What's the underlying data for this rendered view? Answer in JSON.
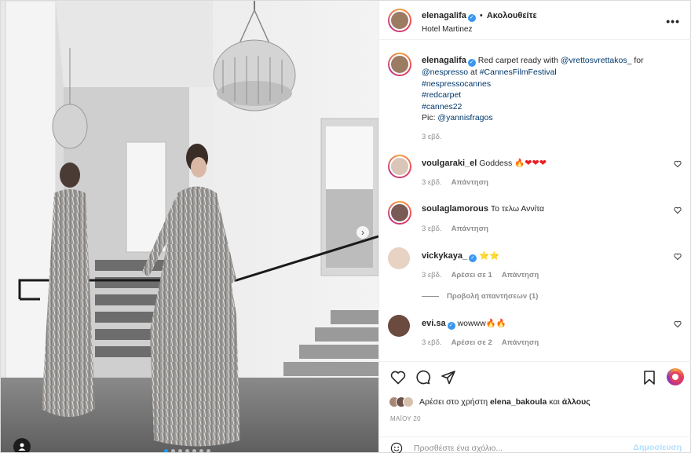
{
  "post": {
    "author": "elenagalifa",
    "separator": "•",
    "follow_label": "Ακολουθείτε",
    "location": "Hotel Martinez",
    "more_label": "•••"
  },
  "caption": {
    "author": "elenagalifa",
    "text_before": "Red carpet ready with ",
    "mention1": "@vrettosvrettakos_",
    "text_mid1": " for",
    "mention2": "@nespresso",
    "text_mid2": " at ",
    "tag1": "#CannesFilmFestival",
    "tag2": "#nespressocannes",
    "tag3": "#redcarpet",
    "tag4": "#cannes22",
    "pic_label": "Pic: ",
    "mention3": "@yannisfragos",
    "time": "3 εβδ."
  },
  "comments": [
    {
      "user": "voulgaraki_el",
      "verified": false,
      "text": "Goddess 🔥",
      "hearts": "❤❤❤",
      "time": "3 εβδ.",
      "likes": "",
      "reply": "Απάντηση"
    },
    {
      "user": "soulaglamorous",
      "verified": false,
      "text": "Το τελω Αννίτα",
      "hearts": "",
      "time": "3 εβδ.",
      "likes": "",
      "reply": "Απάντηση"
    },
    {
      "user": "vickykaya_",
      "verified": true,
      "text": "⭐⭐",
      "hearts": "",
      "time": "3 εβδ.",
      "likes": "Αρέσει σε 1",
      "reply": "Απάντηση"
    },
    {
      "user": "evi.sa",
      "verified": true,
      "text": "wowww🔥🔥",
      "hearts": "",
      "time": "3 εβδ.",
      "likes": "Αρέσει σε 2",
      "reply": "Απάντηση"
    }
  ],
  "view_replies": "Προβολή απαντήσεων (1)",
  "likes": {
    "prefix": "Αρέσει στο χρήστη ",
    "user": "elena_bakoula",
    "suffix_and": " και ",
    "others": "άλλους"
  },
  "date": "ΜΑΪΟΥ 20",
  "add_comment": {
    "placeholder": "Προσθέστε ένα σχόλιο...",
    "post_label": "Δημοσίευση"
  },
  "carousel": {
    "next_icon": "›",
    "slides": 7,
    "active": 0
  },
  "colors": {
    "link": "#00376b",
    "verified": "#3897f0",
    "heart": "#ed1c24",
    "post_disabled": "#b2dffc"
  }
}
